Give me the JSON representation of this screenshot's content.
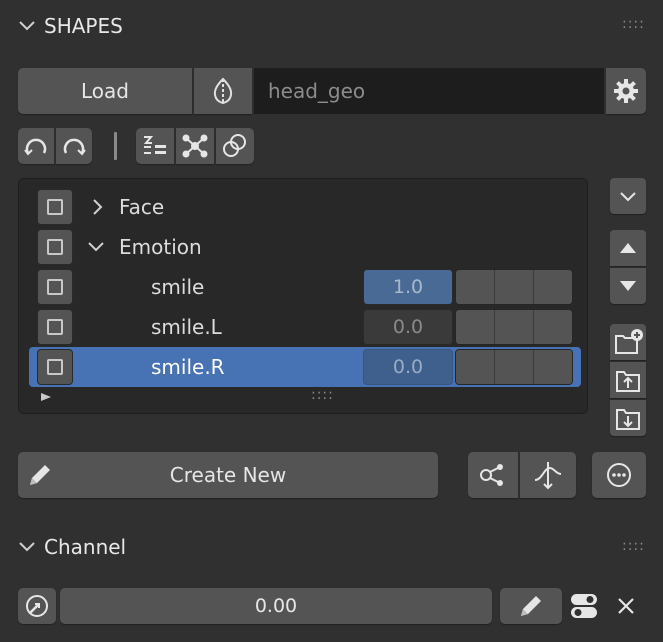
{
  "shapes_panel": {
    "title": "SHAPES",
    "load_label": "Load",
    "mesh_field_value": "head_geo",
    "items": [
      {
        "label": "Face",
        "expanded": false,
        "kind": "group"
      },
      {
        "label": "Emotion",
        "expanded": true,
        "kind": "group"
      },
      {
        "label": "smile",
        "value": "1.0",
        "kind": "shape"
      },
      {
        "label": "smile.L",
        "value": "0.0",
        "kind": "shape"
      },
      {
        "label": "smile.R",
        "value": "0.0",
        "kind": "shape",
        "selected": true
      }
    ],
    "create_new_label": "Create New"
  },
  "channel_panel": {
    "title": "Channel",
    "value": "0.00"
  },
  "colors": {
    "background": "#303030",
    "button": "#545454",
    "field": "#1d1d1d",
    "selection": "#4772b3",
    "active_value": "#4a6a96"
  },
  "icons": [
    "chevron-down-icon",
    "grip-icon",
    "mirror-icon",
    "gear-icon",
    "undo-icon",
    "redo-icon",
    "filter-list-icon",
    "nodes-icon",
    "circles-icon",
    "chevron-right-icon",
    "move-up-icon",
    "move-down-icon",
    "folder-add-icon",
    "folder-up-icon",
    "folder-down-icon",
    "pencil-icon",
    "share-icon",
    "curve-icon",
    "more-icon",
    "dial-icon",
    "toggle-icon",
    "close-icon"
  ]
}
